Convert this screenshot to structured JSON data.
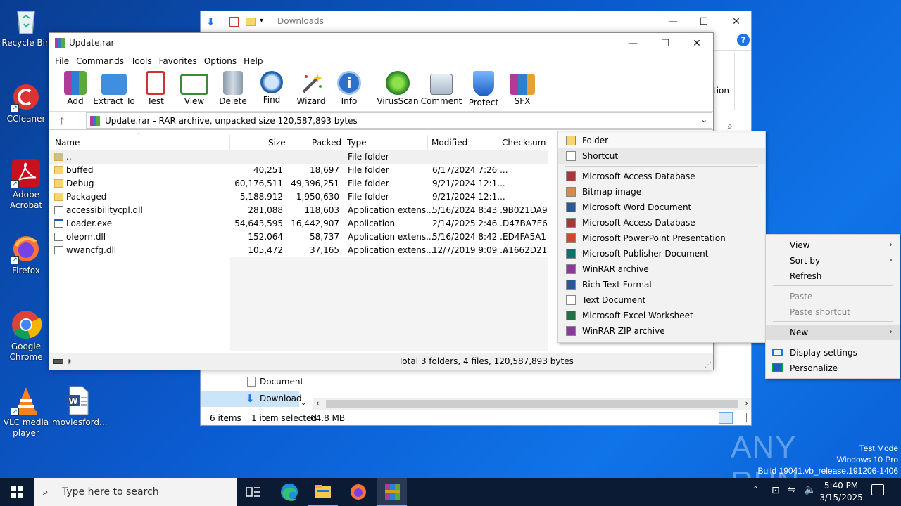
{
  "desktop": {
    "icons": [
      {
        "label": "Recycle Bin"
      },
      {
        "label": "CCleaner"
      },
      {
        "label": "Adobe Acrobat"
      },
      {
        "label": "Firefox"
      },
      {
        "label": "Google Chrome"
      },
      {
        "label": "VLC media player"
      },
      {
        "label": "moviesford..."
      }
    ],
    "watermark": {
      "brand": "ANY RUN",
      "line1": "Test Mode",
      "line2": "Windows 10 Pro",
      "line3": "Build 19041.vb_release.191206-1406"
    }
  },
  "explorer": {
    "title": "Downloads",
    "nav_items": [
      "Document",
      "Download"
    ],
    "right_fragment": "tion",
    "status": {
      "items": "6 items",
      "selected": "1 item selected",
      "size": "64.8 MB"
    }
  },
  "winrar": {
    "title": "Update.rar",
    "menu": [
      "File",
      "Commands",
      "Tools",
      "Favorites",
      "Options",
      "Help"
    ],
    "toolbar": [
      "Add",
      "Extract To",
      "Test",
      "View",
      "Delete",
      "Find",
      "Wizard",
      "Info",
      "VirusScan",
      "Comment",
      "Protect",
      "SFX"
    ],
    "address": "Update.rar - RAR archive, unpacked size 120,587,893 bytes",
    "columns": {
      "name": "Name",
      "size": "Size",
      "packed": "Packed",
      "type": "Type",
      "modified": "Modified",
      "checksum": "Checksum"
    },
    "rows": [
      {
        "name": "..",
        "size": "",
        "packed": "",
        "type": "File folder",
        "modified": "",
        "checksum": ""
      },
      {
        "name": "buffed",
        "size": "40,251",
        "packed": "18,697",
        "type": "File folder",
        "modified": "6/17/2024 7:26 ...",
        "checksum": ""
      },
      {
        "name": "Debug",
        "size": "60,176,511",
        "packed": "49,396,251",
        "type": "File folder",
        "modified": "9/21/2024 12:1...",
        "checksum": ""
      },
      {
        "name": "Packaged",
        "size": "5,188,912",
        "packed": "1,950,630",
        "type": "File folder",
        "modified": "9/21/2024 12:1...",
        "checksum": ""
      },
      {
        "name": "accessibilitycpl.dll",
        "size": "281,088",
        "packed": "118,603",
        "type": "Application extens...",
        "modified": "5/16/2024 8:43 ...",
        "checksum": "9B021DA9"
      },
      {
        "name": "Loader.exe",
        "size": "54,643,595",
        "packed": "16,442,907",
        "type": "Application",
        "modified": "2/14/2025 2:46 ...",
        "checksum": "D47BA7E6"
      },
      {
        "name": "oleprn.dll",
        "size": "152,064",
        "packed": "58,737",
        "type": "Application extens...",
        "modified": "5/16/2024 8:42 ...",
        "checksum": "ED4FA5A1"
      },
      {
        "name": "wwancfg.dll",
        "size": "105,472",
        "packed": "37,165",
        "type": "Application extens...",
        "modified": "12/7/2019 9:09 ...",
        "checksum": "A1662D21"
      }
    ],
    "status": "Total 3 folders, 4 files, 120,587,893 bytes"
  },
  "new_menu": {
    "items": [
      {
        "label": "Folder",
        "icon": "folder-icon"
      },
      {
        "label": "Shortcut",
        "icon": "shortcut-icon"
      },
      {
        "label": "Microsoft Access Database",
        "icon": "access-icon"
      },
      {
        "label": "Bitmap image",
        "icon": "bitmap-icon"
      },
      {
        "label": "Microsoft Word Document",
        "icon": "word-icon"
      },
      {
        "label": "Microsoft Access Database",
        "icon": "access-icon"
      },
      {
        "label": "Microsoft PowerPoint Presentation",
        "icon": "powerpoint-icon"
      },
      {
        "label": "Microsoft Publisher Document",
        "icon": "publisher-icon"
      },
      {
        "label": "WinRAR archive",
        "icon": "winrar-icon"
      },
      {
        "label": "Rich Text Format",
        "icon": "rtf-icon"
      },
      {
        "label": "Text Document",
        "icon": "text-icon"
      },
      {
        "label": "Microsoft Excel Worksheet",
        "icon": "excel-icon"
      },
      {
        "label": "WinRAR ZIP archive",
        "icon": "winrar-zip-icon"
      }
    ]
  },
  "context_menu": {
    "view": "View",
    "sort_by": "Sort by",
    "refresh": "Refresh",
    "paste": "Paste",
    "paste_shortcut": "Paste shortcut",
    "new": "New",
    "display_settings": "Display settings",
    "personalize": "Personalize"
  },
  "taskbar": {
    "search_placeholder": "Type here to search",
    "time": "5:40 PM",
    "date": "3/15/2025"
  }
}
